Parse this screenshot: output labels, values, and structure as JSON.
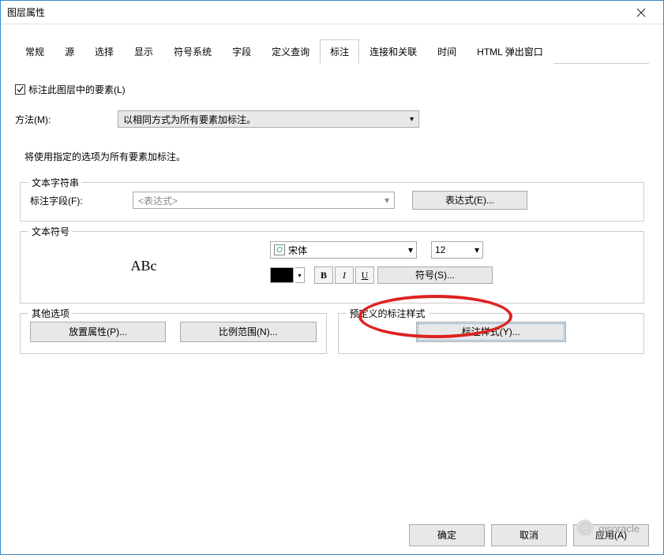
{
  "window": {
    "title": "图层属性"
  },
  "tabs": [
    "常规",
    "源",
    "选择",
    "显示",
    "符号系统",
    "字段",
    "定义查询",
    "标注",
    "连接和关联",
    "时间",
    "HTML 弹出窗口"
  ],
  "activeTab": "标注",
  "checkbox": {
    "label": "标注此图层中的要素(L)",
    "checked": true
  },
  "method": {
    "label": "方法(M):",
    "value": "以相同方式为所有要素加标注。"
  },
  "desc": "将使用指定的选项为所有要素加标注。",
  "textString": {
    "legend": "文本字符串",
    "fieldLabel": "标注字段(F):",
    "fieldValue": "<表达式>",
    "exprBtn": "表达式(E)..."
  },
  "textSymbol": {
    "legend": "文本符号",
    "sample": "ABc",
    "font": "宋体",
    "size": "12",
    "bold": "B",
    "italic": "I",
    "underline": "U",
    "symbolBtn": "符号(S)..."
  },
  "other": {
    "legend": "其他选项",
    "placementBtn": "放置属性(P)...",
    "scaleBtn": "比例范围(N)..."
  },
  "predefined": {
    "legend": "预定义的标注样式",
    "labelStyleBtn": "标注样式(Y)..."
  },
  "footer": {
    "ok": "确定",
    "cancel": "取消",
    "apply": "应用(A)"
  },
  "watermark": "gisoracle"
}
